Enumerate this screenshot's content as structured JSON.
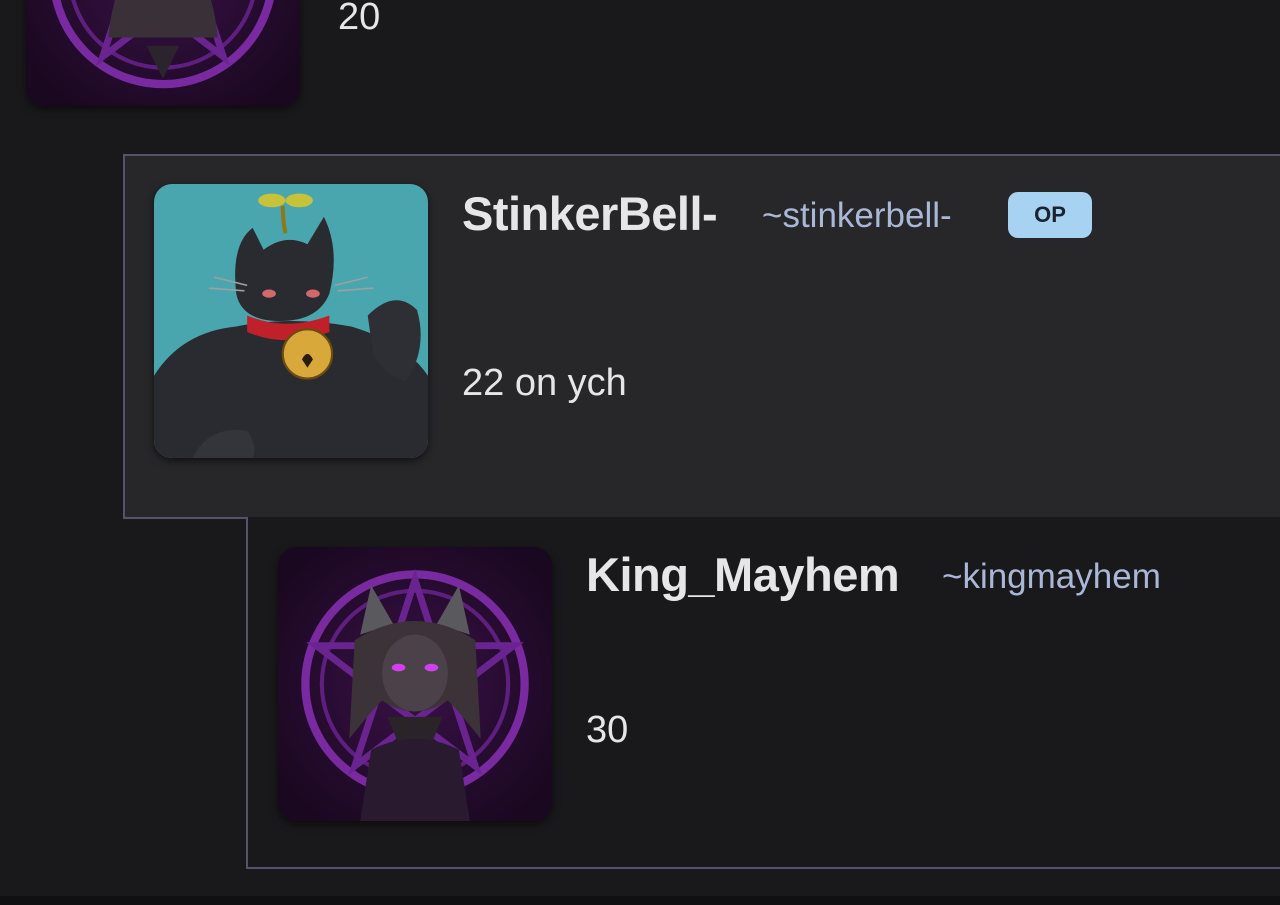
{
  "comments": [
    {
      "body": "20",
      "avatar": "pentagram-cat-avatar"
    },
    {
      "username": "StinkerBell-",
      "handle": "~stinkerbell-",
      "badge": "OP",
      "body": "22 on ych",
      "avatar": "black-cat-with-bell-avatar"
    },
    {
      "username": "King_Mayhem",
      "handle": "~kingmayhem",
      "body": "30",
      "avatar": "pentagram-cat-avatar"
    }
  ],
  "colors": {
    "background": "#19191b",
    "highlight_comment": "#27272a",
    "thread_border": "#55526a",
    "username": "#e6e6e8",
    "handle": "#a9b8d6",
    "op_badge": "#a8d2f2"
  }
}
